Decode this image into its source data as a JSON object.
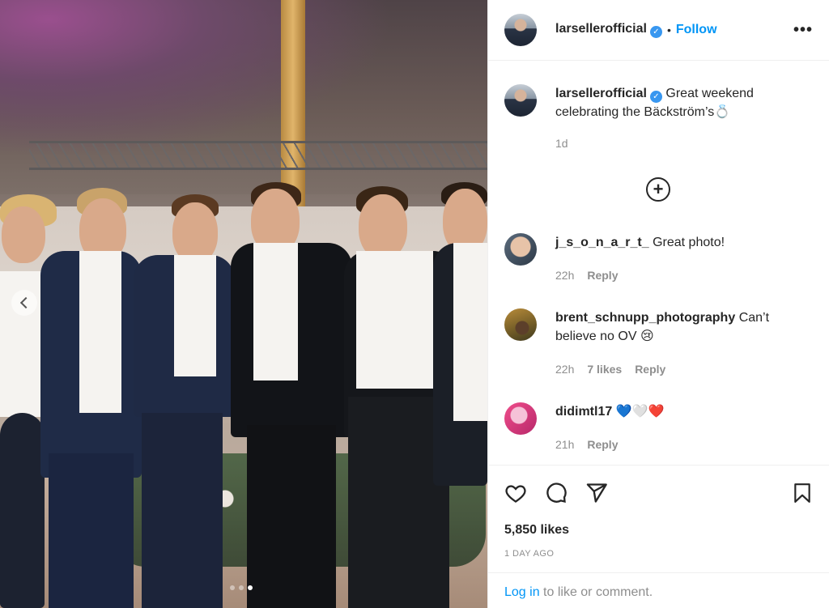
{
  "post": {
    "image_alt": "",
    "carousel": {
      "count": 3,
      "active_index": 2
    }
  },
  "header": {
    "username": "larsellerofficial",
    "verified": true,
    "separator": "•",
    "follow_label": "Follow",
    "more_label": "•••"
  },
  "caption": {
    "username": "larsellerofficial",
    "text": "Great weekend celebrating the Bäckström’s💍",
    "time": "1d"
  },
  "comments": [
    {
      "username": "j_s_o_n_a_r_t_",
      "text": "Great photo!",
      "time": "22h",
      "likes": "",
      "reply_label": "Reply"
    },
    {
      "username": "brent_schnupp_photography",
      "text": "Can’t believe no OV 😢",
      "time": "22h",
      "likes": "7 likes",
      "reply_label": "Reply"
    },
    {
      "username": "didimtl17",
      "text": "💙🤍❤️",
      "time": "21h",
      "likes": "",
      "reply_label": "Reply"
    }
  ],
  "actions": {
    "likes": "5,850 likes",
    "date": "1 DAY AGO",
    "login_link": "Log in",
    "login_suffix": " to like or comment."
  },
  "icons": [
    "like-heart-icon",
    "comment-icon",
    "share-icon",
    "bookmark-icon",
    "load-more-plus-icon",
    "prev-arrow-icon"
  ],
  "colors": {
    "link": "#0095f6",
    "muted": "#8e8e8e",
    "text": "#262626",
    "verified": "#3897f0"
  }
}
